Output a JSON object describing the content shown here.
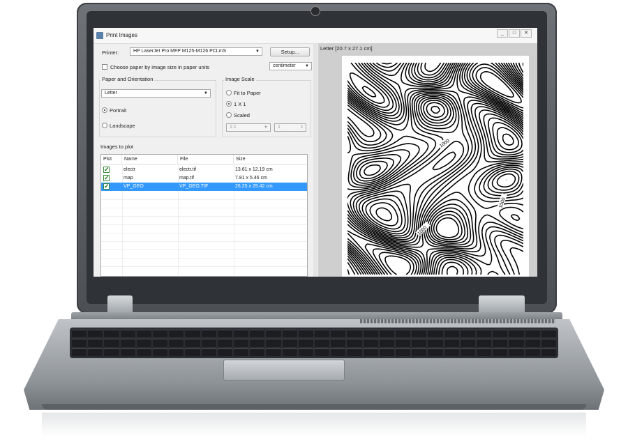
{
  "window": {
    "title": "Print Images",
    "controls": [
      "_",
      "□",
      "✕"
    ]
  },
  "printer": {
    "label": "Printer:",
    "selected": "HP LaserJet Pro MFP M125-M126 PCLmS",
    "setup_label": "Setup..."
  },
  "paper_option": {
    "checkbox_label": "Choose paper by image size in paper units",
    "checked": false,
    "units": "centimeter"
  },
  "paper_orientation": {
    "title": "Paper and Orientation",
    "paper": "Letter",
    "portrait_label": "Portrait",
    "landscape_label": "Landscape",
    "selected": "Portrait"
  },
  "image_scale": {
    "title": "Image Scale",
    "fit_label": "Fit to Paper",
    "one_label": "1 X 1",
    "scaled_label": "Scaled",
    "selected": "1 X 1",
    "ratio_value": "1:1",
    "spin_value": "1"
  },
  "images": {
    "title": "Images to plot",
    "columns": [
      "Plot",
      "Name",
      "File",
      "Size"
    ],
    "rows": [
      {
        "plot": true,
        "name": "electr",
        "file": "electr.tif",
        "size": "13.61 x 12.19 cm",
        "selected": false
      },
      {
        "plot": true,
        "name": "map",
        "file": "map.tif",
        "size": "7.81 x 5.46 cm",
        "selected": false
      },
      {
        "plot": true,
        "name": "VP_GEO",
        "file": "VP_GEO.TIF",
        "size": "26.25 x 29.42 cm",
        "selected": true
      }
    ]
  },
  "preview": {
    "label": "Letter [20.7 x 27.1 cm]",
    "contour_labels": [
      "1000",
      "1000",
      "1000"
    ]
  },
  "colors": {
    "selection": "#3399ff",
    "check": "#137a13"
  }
}
